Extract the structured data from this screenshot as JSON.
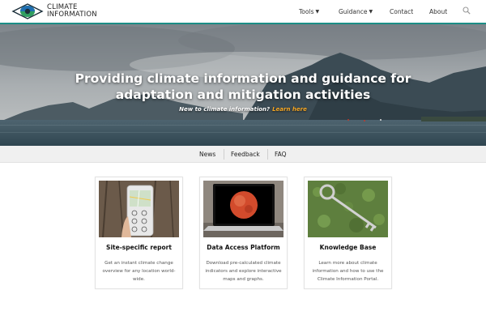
{
  "header": {
    "logo_line1": "CLIMATE",
    "logo_line2": "INFORMATION",
    "nav": [
      {
        "label": "Tools",
        "has_dropdown": true
      },
      {
        "label": "Guidance",
        "has_dropdown": true
      },
      {
        "label": "Contact",
        "has_dropdown": false
      },
      {
        "label": "About",
        "has_dropdown": false
      }
    ],
    "search_icon": "search-icon",
    "accent_color": "#1b8e86"
  },
  "hero": {
    "title_line1": "Providing climate information and guidance for",
    "title_line2": "adaptation and mitigation activities",
    "subtitle_prefix": "New to climate information?",
    "learn_link": "Learn here",
    "link_color": "#f5a623"
  },
  "subnav": {
    "items": [
      "News",
      "Feedback",
      "FAQ"
    ]
  },
  "cards": [
    {
      "title": "Site-specific report",
      "desc": "Get an instant climate change overview for any location world-wide."
    },
    {
      "title": "Data Access Platform",
      "desc": "Download pre-calculated climate indicators and explore interactive maps and graphs."
    },
    {
      "title": "Knowledge Base",
      "desc": "Learn more about climate information and how to use the Climate Information Portal."
    }
  ]
}
